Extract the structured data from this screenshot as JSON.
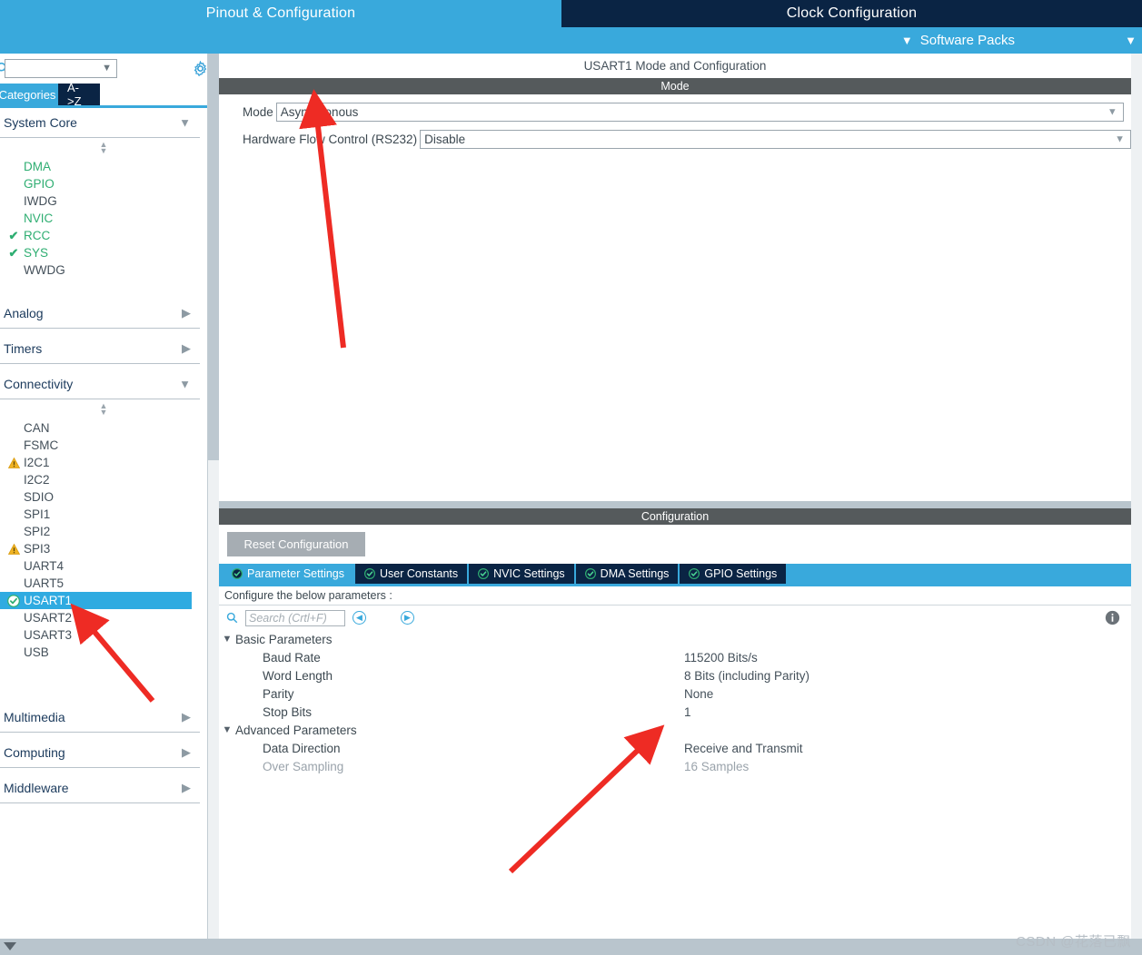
{
  "window": {
    "view_tabs": [
      {
        "label": "Pinout & Configuration",
        "active": true
      },
      {
        "label": "Clock Configuration",
        "active": false
      }
    ],
    "software_packs": "Software Packs",
    "watermark": "CSDN @花落已飘"
  },
  "sidebar": {
    "search_value": "",
    "gear_icon": "gear-icon",
    "tabs": [
      {
        "label": "Categories",
        "active": true
      },
      {
        "label": "A->Z",
        "active": false
      }
    ],
    "groups": [
      {
        "name": "System Core",
        "expanded": true,
        "items": [
          {
            "label": "DMA",
            "state": "configured",
            "icon": "none"
          },
          {
            "label": "GPIO",
            "state": "configured",
            "icon": "none"
          },
          {
            "label": "IWDG",
            "state": "default",
            "icon": "none"
          },
          {
            "label": "NVIC",
            "state": "configured",
            "icon": "none"
          },
          {
            "label": "RCC",
            "state": "configured",
            "icon": "check-icon"
          },
          {
            "label": "SYS",
            "state": "configured",
            "icon": "check-icon"
          },
          {
            "label": "WWDG",
            "state": "default",
            "icon": "none"
          }
        ]
      },
      {
        "name": "Analog",
        "expanded": false,
        "items": []
      },
      {
        "name": "Timers",
        "expanded": false,
        "items": []
      },
      {
        "name": "Connectivity",
        "expanded": true,
        "items": [
          {
            "label": "CAN",
            "state": "default",
            "icon": "none"
          },
          {
            "label": "FSMC",
            "state": "default",
            "icon": "none"
          },
          {
            "label": "I2C1",
            "state": "default",
            "icon": "warning-icon"
          },
          {
            "label": "I2C2",
            "state": "default",
            "icon": "none"
          },
          {
            "label": "SDIO",
            "state": "default",
            "icon": "none"
          },
          {
            "label": "SPI1",
            "state": "default",
            "icon": "none"
          },
          {
            "label": "SPI2",
            "state": "default",
            "icon": "none"
          },
          {
            "label": "SPI3",
            "state": "default",
            "icon": "warning-icon"
          },
          {
            "label": "UART4",
            "state": "default",
            "icon": "none"
          },
          {
            "label": "UART5",
            "state": "default",
            "icon": "none"
          },
          {
            "label": "USART1",
            "state": "selected",
            "icon": "ok-circle-icon"
          },
          {
            "label": "USART2",
            "state": "default",
            "icon": "none"
          },
          {
            "label": "USART3",
            "state": "default",
            "icon": "none"
          },
          {
            "label": "USB",
            "state": "default",
            "icon": "none"
          }
        ]
      },
      {
        "name": "Multimedia",
        "expanded": false,
        "items": []
      },
      {
        "name": "Computing",
        "expanded": false,
        "items": []
      },
      {
        "name": "Middleware",
        "expanded": false,
        "items": []
      }
    ]
  },
  "main": {
    "title": "USART1 Mode and Configuration",
    "mode_band": "Mode",
    "mode_fields": [
      {
        "label": "Mode",
        "value": "Asynchronous"
      },
      {
        "label": "Hardware Flow Control (RS232)",
        "value": "Disable"
      }
    ],
    "config_band": "Configuration",
    "reset_button": "Reset Configuration",
    "tabs": [
      {
        "label": "Parameter Settings",
        "active": true
      },
      {
        "label": "User Constants",
        "active": false
      },
      {
        "label": "NVIC Settings",
        "active": false
      },
      {
        "label": "DMA Settings",
        "active": false
      },
      {
        "label": "GPIO Settings",
        "active": false
      }
    ],
    "configure_note": "Configure the below parameters :",
    "search_placeholder": "Search (Crtl+F)",
    "search_value": "",
    "nav_prev_icon": "chevron-left-circle-icon",
    "nav_next_icon": "chevron-right-circle-icon",
    "info_icon": "info-icon",
    "parameters": [
      {
        "kind": "section",
        "name": "Basic Parameters",
        "value": "",
        "expanded": true,
        "disabled": false
      },
      {
        "kind": "child",
        "name": "Baud Rate",
        "value": "115200 Bits/s",
        "disabled": false
      },
      {
        "kind": "child",
        "name": "Word Length",
        "value": "8 Bits (including Parity)",
        "disabled": false
      },
      {
        "kind": "child",
        "name": "Parity",
        "value": "None",
        "disabled": false
      },
      {
        "kind": "child",
        "name": "Stop Bits",
        "value": "1",
        "disabled": false
      },
      {
        "kind": "section",
        "name": "Advanced Parameters",
        "value": "",
        "expanded": true,
        "disabled": false
      },
      {
        "kind": "child",
        "name": "Data Direction",
        "value": "Receive and Transmit",
        "disabled": false
      },
      {
        "kind": "child",
        "name": "Over Sampling",
        "value": "16 Samples",
        "disabled": true
      }
    ]
  },
  "colors": {
    "accent_blue": "#39a9dc",
    "dark_navy": "#0a2444",
    "band_gray": "#555a5c",
    "green_ok": "#2fae72",
    "warning_yellow": "#f0b323",
    "selection_blue": "#2fabe1",
    "annotation_red": "#ee2b24"
  }
}
